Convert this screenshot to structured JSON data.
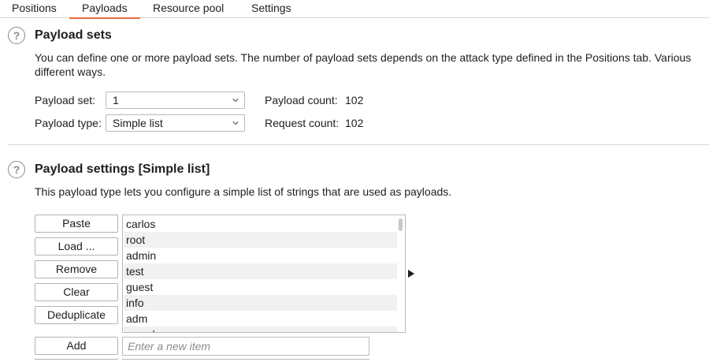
{
  "tabs": [
    "Positions",
    "Payloads",
    "Resource pool",
    "Settings"
  ],
  "active_tab": "Payloads",
  "payload_sets": {
    "help": "?",
    "title": "Payload sets",
    "description_line1": "You can define one or more payload sets. The number of payload sets depends on the attack type defined in the Positions tab. Various",
    "description_line2": "different ways.",
    "set_label": "Payload set:",
    "set_value": "1",
    "type_label": "Payload type:",
    "type_value": "Simple list",
    "payload_count_label": "Payload count:",
    "payload_count": "102",
    "request_count_label": "Request count:",
    "request_count": "102"
  },
  "payload_settings": {
    "help": "?",
    "title": "Payload settings [Simple list]",
    "description": "This payload type lets you configure a simple list of strings that are used as payloads.",
    "buttons": {
      "paste": "Paste",
      "load": "Load ...",
      "remove": "Remove",
      "clear": "Clear",
      "deduplicate": "Deduplicate",
      "add": "Add"
    },
    "items": [
      "carlos",
      "root",
      "admin",
      "test",
      "guest",
      "info",
      "adm",
      "mysql"
    ],
    "new_item_placeholder": "Enter a new item"
  },
  "colors": {
    "accent": "#e8693d",
    "row_alt": "#f1f1f1",
    "border": "#b9b9b9"
  }
}
